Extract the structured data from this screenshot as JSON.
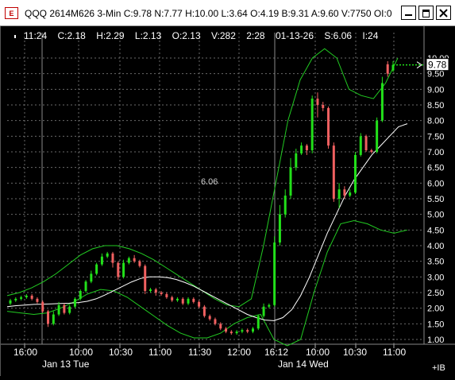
{
  "window": {
    "icon_label": "E",
    "title": "QQQ 2614M626 3-Min C:9.78 N:7.77 H:10.00 L:3.64 O:4.19 B:9.31 A:9.60 V:7750 OI:0"
  },
  "info_bar": {
    "time": "11:24",
    "close": "C:2.18",
    "high": "H:2.29",
    "low": "L:2.13",
    "open": "O:2.13",
    "volume": "V:282",
    "bar_time": "2:28",
    "date": "01-13-26",
    "study": "S:6.06",
    "interval": "I:24"
  },
  "cursor_readout": "6.06",
  "last_price_label": "9.78",
  "colors": {
    "background": "#000000",
    "up_candle": "#22e01a",
    "down_candle": "#f06060",
    "bands": "#22cc22",
    "moving_average": "#ffffff",
    "grid": "#6a6a6a"
  },
  "chart_data": {
    "type": "candlestick",
    "ylim": [
      0.95,
      10.25
    ],
    "y_tick_labels": [
      "10.00",
      "9.50",
      "9.00",
      "8.50",
      "8.00",
      "7.50",
      "7.00",
      "6.50",
      "6.00",
      "5.50",
      "5.00",
      "4.50",
      "4.00",
      "3.50",
      "3.00",
      "2.50",
      "2.00",
      "1.50",
      "1.00"
    ],
    "y_ticks": [
      10.0,
      9.5,
      9.0,
      8.5,
      8.0,
      7.5,
      7.0,
      6.5,
      6.0,
      5.5,
      5.0,
      4.5,
      4.0,
      3.5,
      3.0,
      2.5,
      2.0,
      1.5,
      1.0
    ],
    "x_tick_labels": [
      "16:00",
      "10:00",
      "10:30",
      "11:00",
      "11:30",
      "12:00",
      "16:12",
      "10:00",
      "10:30",
      "11:00"
    ],
    "date_labels": [
      "Jan 13 Tue",
      "Jan 14 Wed"
    ],
    "ib_label": "+IB",
    "candles": [
      {
        "o": 2.15,
        "c": 2.25,
        "h": 2.3,
        "l": 2.1
      },
      {
        "o": 2.25,
        "c": 2.3,
        "h": 2.35,
        "l": 2.2
      },
      {
        "o": 2.3,
        "c": 2.35,
        "h": 2.4,
        "l": 2.25
      },
      {
        "o": 2.35,
        "c": 2.4,
        "h": 2.45,
        "l": 2.3
      },
      {
        "o": 2.4,
        "c": 2.3,
        "h": 2.45,
        "l": 2.25
      },
      {
        "o": 2.3,
        "c": 2.2,
        "h": 2.35,
        "l": 2.15
      },
      {
        "o": 2.2,
        "c": 1.9,
        "h": 2.25,
        "l": 1.85
      },
      {
        "o": 1.9,
        "c": 1.5,
        "h": 1.95,
        "l": 1.4
      },
      {
        "o": 1.5,
        "c": 1.8,
        "h": 1.9,
        "l": 1.45
      },
      {
        "o": 1.8,
        "c": 2.1,
        "h": 2.2,
        "l": 1.75
      },
      {
        "o": 2.1,
        "c": 1.85,
        "h": 2.15,
        "l": 1.8
      },
      {
        "o": 1.85,
        "c": 2.05,
        "h": 2.1,
        "l": 1.8
      },
      {
        "o": 2.05,
        "c": 2.3,
        "h": 2.35,
        "l": 2.0
      },
      {
        "o": 2.3,
        "c": 2.55,
        "h": 2.6,
        "l": 2.25
      },
      {
        "o": 2.55,
        "c": 2.85,
        "h": 2.9,
        "l": 2.5
      },
      {
        "o": 2.85,
        "c": 3.1,
        "h": 3.2,
        "l": 2.8
      },
      {
        "o": 3.1,
        "c": 3.4,
        "h": 3.45,
        "l": 3.05
      },
      {
        "o": 3.4,
        "c": 3.65,
        "h": 3.75,
        "l": 3.35
      },
      {
        "o": 3.65,
        "c": 3.75,
        "h": 3.8,
        "l": 3.6
      },
      {
        "o": 3.75,
        "c": 3.45,
        "h": 3.8,
        "l": 3.3
      },
      {
        "o": 3.45,
        "c": 3.0,
        "h": 3.5,
        "l": 2.9
      },
      {
        "o": 3.0,
        "c": 3.45,
        "h": 3.55,
        "l": 2.95
      },
      {
        "o": 3.45,
        "c": 3.6,
        "h": 3.65,
        "l": 3.4
      },
      {
        "o": 3.6,
        "c": 3.5,
        "h": 3.7,
        "l": 3.45
      },
      {
        "o": 3.5,
        "c": 3.35,
        "h": 3.55,
        "l": 3.3
      },
      {
        "o": 3.35,
        "c": 2.55,
        "h": 3.4,
        "l": 2.45
      },
      {
        "o": 2.55,
        "c": 2.6,
        "h": 2.65,
        "l": 2.5
      },
      {
        "o": 2.6,
        "c": 2.5,
        "h": 2.65,
        "l": 2.4
      },
      {
        "o": 2.5,
        "c": 2.45,
        "h": 2.55,
        "l": 2.4
      },
      {
        "o": 2.45,
        "c": 2.35,
        "h": 2.5,
        "l": 2.3
      },
      {
        "o": 2.35,
        "c": 2.25,
        "h": 2.4,
        "l": 2.2
      },
      {
        "o": 2.25,
        "c": 2.3,
        "h": 2.35,
        "l": 2.2
      },
      {
        "o": 2.3,
        "c": 2.15,
        "h": 2.35,
        "l": 2.1
      },
      {
        "o": 2.15,
        "c": 2.3,
        "h": 2.35,
        "l": 2.1
      },
      {
        "o": 2.3,
        "c": 2.2,
        "h": 2.35,
        "l": 2.15
      },
      {
        "o": 2.2,
        "c": 2.05,
        "h": 2.25,
        "l": 2.0
      },
      {
        "o": 2.05,
        "c": 1.75,
        "h": 2.1,
        "l": 1.7
      },
      {
        "o": 1.75,
        "c": 1.65,
        "h": 1.8,
        "l": 1.6
      },
      {
        "o": 1.65,
        "c": 1.5,
        "h": 1.7,
        "l": 1.45
      },
      {
        "o": 1.5,
        "c": 1.35,
        "h": 1.55,
        "l": 1.3
      },
      {
        "o": 1.35,
        "c": 1.25,
        "h": 1.4,
        "l": 1.2
      },
      {
        "o": 1.25,
        "c": 1.2,
        "h": 1.3,
        "l": 1.15
      },
      {
        "o": 1.2,
        "c": 1.25,
        "h": 1.3,
        "l": 1.15
      },
      {
        "o": 1.25,
        "c": 1.3,
        "h": 1.35,
        "l": 1.2
      },
      {
        "o": 1.3,
        "c": 1.25,
        "h": 1.35,
        "l": 1.2
      },
      {
        "o": 1.25,
        "c": 1.35,
        "h": 1.4,
        "l": 1.2
      },
      {
        "o": 1.35,
        "c": 1.75,
        "h": 1.8,
        "l": 1.3
      },
      {
        "o": 1.75,
        "c": 2.05,
        "h": 2.15,
        "l": 1.7
      },
      {
        "o": 2.05,
        "c": 2.1,
        "h": 2.15,
        "l": 2.0
      },
      {
        "o": 2.1,
        "c": 4.1,
        "h": 4.3,
        "l": 2.05
      },
      {
        "o": 4.1,
        "c": 5.0,
        "h": 5.3,
        "l": 4.0
      },
      {
        "o": 5.0,
        "c": 5.6,
        "h": 5.8,
        "l": 4.9
      },
      {
        "o": 5.6,
        "c": 6.5,
        "h": 6.8,
        "l": 5.5
      },
      {
        "o": 6.5,
        "c": 6.95,
        "h": 7.1,
        "l": 6.4
      },
      {
        "o": 6.95,
        "c": 7.2,
        "h": 7.3,
        "l": 6.9
      },
      {
        "o": 7.2,
        "c": 7.05,
        "h": 7.25,
        "l": 6.9
      },
      {
        "o": 7.05,
        "c": 8.7,
        "h": 8.8,
        "l": 6.95
      },
      {
        "o": 8.7,
        "c": 8.5,
        "h": 8.9,
        "l": 8.1
      },
      {
        "o": 8.5,
        "c": 8.4,
        "h": 8.6,
        "l": 8.3
      },
      {
        "o": 8.4,
        "c": 7.2,
        "h": 8.45,
        "l": 7.1
      },
      {
        "o": 7.2,
        "c": 5.5,
        "h": 7.3,
        "l": 5.4
      },
      {
        "o": 5.5,
        "c": 5.8,
        "h": 6.0,
        "l": 5.2
      },
      {
        "o": 5.8,
        "c": 5.6,
        "h": 5.9,
        "l": 5.5
      },
      {
        "o": 5.6,
        "c": 5.7,
        "h": 5.8,
        "l": 5.55
      },
      {
        "o": 5.7,
        "c": 6.9,
        "h": 7.0,
        "l": 5.65
      },
      {
        "o": 6.9,
        "c": 7.5,
        "h": 7.6,
        "l": 6.85
      },
      {
        "o": 7.5,
        "c": 7.05,
        "h": 7.55,
        "l": 7.0
      },
      {
        "o": 7.05,
        "c": 7.0,
        "h": 7.1,
        "l": 6.95
      },
      {
        "o": 7.0,
        "c": 8.0,
        "h": 8.1,
        "l": 6.95
      },
      {
        "o": 8.0,
        "c": 9.2,
        "h": 9.4,
        "l": 7.95
      },
      {
        "o": 9.8,
        "c": 9.5,
        "h": 9.9,
        "l": 9.4
      },
      {
        "o": 9.6,
        "c": 9.78,
        "h": 9.9,
        "l": 9.55
      }
    ],
    "moving_average": [
      2.05,
      2.08,
      2.1,
      2.12,
      2.13,
      2.14,
      2.15,
      2.16,
      2.18,
      2.22,
      2.3,
      2.42,
      2.56,
      2.7,
      2.84,
      2.95,
      3.0,
      3.0,
      2.98,
      2.92,
      2.82,
      2.7,
      2.55,
      2.4,
      2.25,
      2.1,
      1.95,
      1.8,
      1.7,
      1.62,
      1.6,
      1.7,
      1.95,
      2.4,
      3.0,
      3.7,
      4.4,
      5.0,
      5.6,
      6.1,
      6.5,
      6.9,
      7.2,
      7.5,
      7.8,
      7.9
    ],
    "upper_band": [
      2.4,
      2.5,
      2.65,
      2.85,
      3.1,
      3.4,
      3.7,
      3.9,
      4.0,
      4.0,
      3.9,
      3.75,
      3.55,
      3.3,
      3.05,
      2.8,
      2.55,
      2.3,
      2.1,
      2.05,
      2.3,
      4.0,
      6.0,
      8.0,
      9.3,
      10.0,
      10.3,
      10.0,
      9.0,
      8.8,
      8.7,
      9.2,
      10.0
    ],
    "lower_band": [
      1.9,
      1.85,
      1.8,
      1.85,
      2.0,
      2.2,
      2.45,
      2.6,
      2.55,
      2.35,
      2.05,
      1.75,
      1.45,
      1.2,
      1.05,
      1.05,
      1.2,
      1.5,
      1.7,
      1.8,
      1.0,
      0.8,
      1.0,
      2.5,
      3.8,
      4.7,
      4.8,
      4.7,
      4.5,
      4.4,
      4.5
    ]
  }
}
